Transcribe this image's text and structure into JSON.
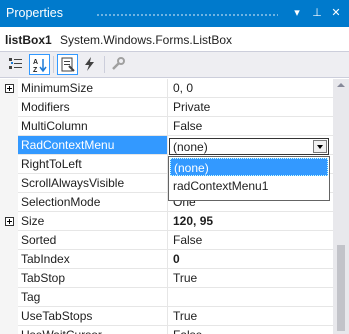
{
  "window": {
    "title": "Properties"
  },
  "window_controls": {
    "dropdown": "▾",
    "pin": "⊥",
    "close": "✕"
  },
  "object": {
    "name": "listBox1",
    "type": "System.Windows.Forms.ListBox"
  },
  "toolbar": {
    "buttons": [
      {
        "name": "categorized",
        "icon": "categorized-icon",
        "active": false
      },
      {
        "name": "alphabetical",
        "icon": "sort-az-icon",
        "active": true
      },
      {
        "name": "properties",
        "icon": "properties-icon",
        "active": true
      },
      {
        "name": "events",
        "icon": "lightning-icon",
        "active": false
      },
      {
        "name": "property-pages",
        "icon": "wrench-icon",
        "active": false
      }
    ]
  },
  "properties": [
    {
      "name": "MinimumSize",
      "value": "0, 0",
      "expandable": true
    },
    {
      "name": "Modifiers",
      "value": "Private"
    },
    {
      "name": "MultiColumn",
      "value": "False"
    },
    {
      "name": "RadContextMenu",
      "value": "(none)",
      "selected": true,
      "editing": true
    },
    {
      "name": "RightToLeft",
      "value": ""
    },
    {
      "name": "ScrollAlwaysVisible",
      "value": ""
    },
    {
      "name": "SelectionMode",
      "value": "One"
    },
    {
      "name": "Size",
      "value": "120, 95",
      "expandable": true,
      "bold": true
    },
    {
      "name": "Sorted",
      "value": "False"
    },
    {
      "name": "TabIndex",
      "value": "0",
      "bold": true
    },
    {
      "name": "TabStop",
      "value": "True"
    },
    {
      "name": "Tag",
      "value": ""
    },
    {
      "name": "UseTabStops",
      "value": "True"
    },
    {
      "name": "UseWaitCursor",
      "value": "False"
    }
  ],
  "editor": {
    "value": "(none)",
    "options": [
      "(none)",
      "radContextMenu1"
    ],
    "selected_index": 0
  },
  "colors": {
    "accent": "#007acc",
    "selection": "#3399ff"
  }
}
